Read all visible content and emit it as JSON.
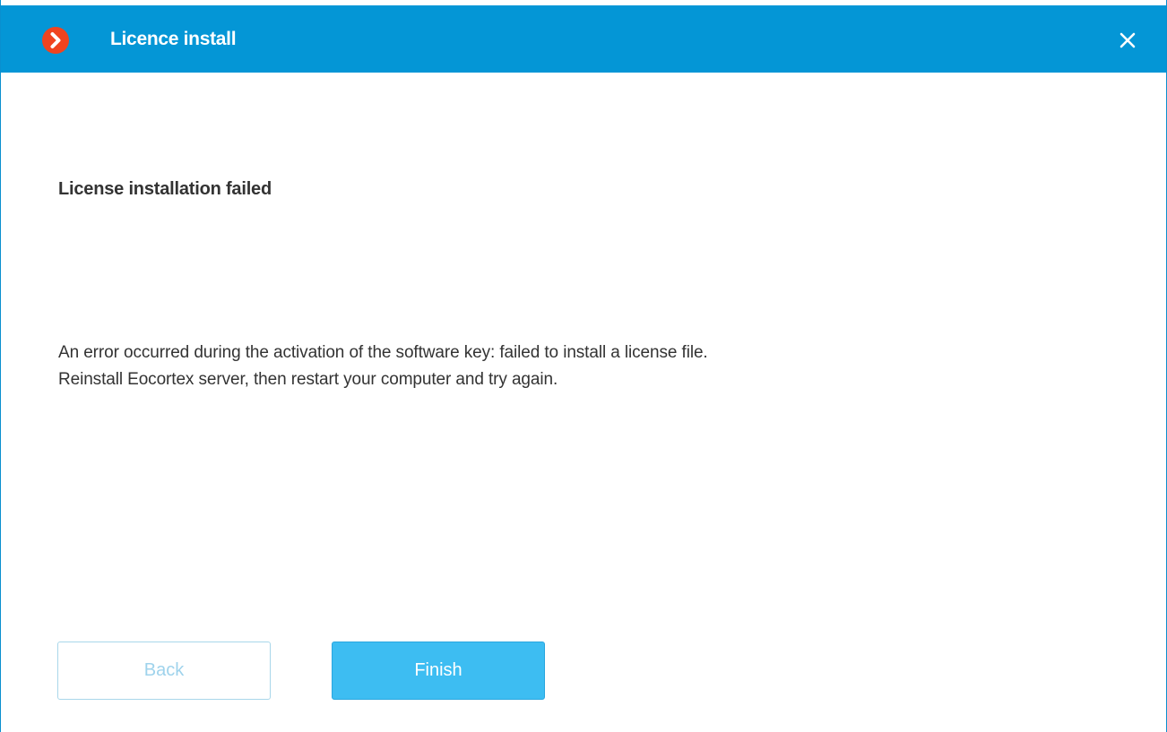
{
  "window": {
    "title": "Licence install",
    "app_icon": "chevron-right-icon",
    "close_icon": "close-icon",
    "colors": {
      "titlebar": "#0496d6",
      "app_icon_bg": "#f0441f",
      "finish_button": "#3dbdf2",
      "back_button_text": "#9fd3ec"
    }
  },
  "content": {
    "heading": "License installation failed",
    "message_lines": [
      "An error occurred during the activation of the software key: failed to install a license file.",
      "Reinstall Eocortex server, then restart your computer and try again."
    ]
  },
  "buttons": {
    "back_label": "Back",
    "finish_label": "Finish"
  }
}
